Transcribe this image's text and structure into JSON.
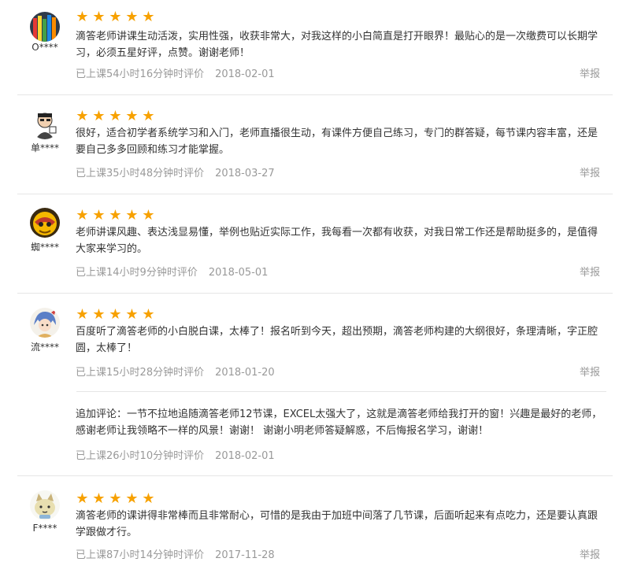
{
  "reviews": [
    {
      "user": "O****",
      "rating": "★★★★★",
      "text": "滴答老师讲课生动活泼，实用性强，收获非常大，对我这样的小白简直是打开眼界！最贴心的是一次缴费可以长期学习，必须五星好评，点赞。谢谢老师！",
      "duration": "已上课54小时16分钟时评价",
      "date": "2018-02-01",
      "report": "举报"
    },
    {
      "user": "单****",
      "rating": "★★★★★",
      "text": "很好，适合初学者系统学习和入门，老师直播很生动，有课件方便自己练习，专门的群答疑，每节课内容丰富，还是要自己多多回顾和练习才能掌握。",
      "duration": "已上课35小时48分钟时评价",
      "date": "2018-03-27",
      "report": "举报"
    },
    {
      "user": "蜘****",
      "rating": "★★★★★",
      "text": "老师讲课风趣、表达浅显易懂，举例也贴近实际工作，我每看一次都有收获，对我日常工作还是帮助挺多的，是值得大家来学习的。",
      "duration": "已上课14小时9分钟时评价",
      "date": "2018-05-01",
      "report": "举报"
    },
    {
      "user": "流****",
      "rating": "★★★★★",
      "text": "百度听了滴答老师的小白脱白课，太棒了！报名听到今天，超出预期，滴答老师构建的大纲很好，条理清晰，字正腔圆，太棒了！",
      "duration": "已上课15小时28分钟时评价",
      "date": "2018-01-20",
      "report": "举报",
      "followup": {
        "text": "追加评论：一节不拉地追随滴答老师12节课，EXCEL太强大了，这就是滴答老师给我打开的窗！兴趣是最好的老师，感谢老师让我领略不一样的风景！谢谢！ 谢谢小明老师答疑解惑，不后悔报名学习，谢谢！",
        "duration": "已上课26小时10分钟时评价",
        "date": "2018-02-01"
      }
    },
    {
      "user": "F****",
      "rating": "★★★★★",
      "text": "滴答老师的课讲得非常棒而且非常耐心，可惜的是我由于加班中间落了几节课，后面听起来有点吃力，还是要认真跟学跟做才行。",
      "duration": "已上课87小时14分钟时评价",
      "date": "2017-11-28",
      "report": "举报"
    }
  ],
  "colors": {
    "star": "#f7a100",
    "meta": "#999999",
    "text": "#333333",
    "divider": "#e6e6e6"
  },
  "icons": [
    "star-icon",
    "avatar-pencils",
    "avatar-cartoon-person",
    "avatar-yellow-mask",
    "avatar-anime-girl",
    "avatar-cartoon-cat"
  ]
}
